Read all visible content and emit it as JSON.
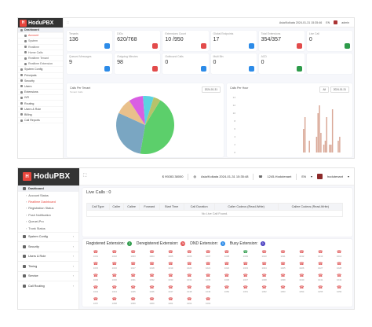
{
  "top": {
    "brand": "HoduPBX",
    "topbar": {
      "expand_icon": "expand-icon",
      "timezone": "Asia/Kolkata 2024-01-31 15:35:46",
      "language": "EN",
      "user": "admin"
    },
    "sidebar": [
      "Dashboard",
      "Account",
      "System",
      "Realtime",
      "Home Calls",
      "Realtime Tenant",
      "Realtime Extension",
      "System Config",
      "Principals",
      "Security",
      "Users",
      "Extensions",
      "IVR",
      "Routing",
      "Users & Role",
      "Billing",
      "Call Reports"
    ],
    "cards": [
      {
        "label": "Tenants",
        "value": "136",
        "color": "#2c8be8"
      },
      {
        "label": "DIDs",
        "value": "620/768",
        "color": "#e24b4b"
      },
      {
        "label": "Extensions Count",
        "value": "10 /950",
        "color": "#e24b4b"
      },
      {
        "label": "Global Endpoints",
        "value": "17",
        "color": "#2c8be8"
      },
      {
        "label": "Total Extensions",
        "value": "354/357",
        "color": "#e24b4b"
      },
      {
        "label": "Live Call",
        "value": "0",
        "color": "#2d9b4a"
      },
      {
        "label": "Queued Messages",
        "value": "9",
        "color": "#2c8be8"
      },
      {
        "label": "Outgoing Minutes",
        "value": "98",
        "color": "#e24b4b"
      },
      {
        "label": "Outbound Calls",
        "value": "0",
        "color": "#2c8be8"
      },
      {
        "label": "Multi Bin",
        "value": "0",
        "color": "#2c8be8"
      },
      {
        "label": "ACD",
        "value": "0",
        "color": "#2d9b4a"
      },
      {
        "label": "",
        "value": "",
        "color": "#ffffff"
      }
    ],
    "pie_panel": {
      "title": "Calls Per Tenant",
      "subtitle": "Tenant Calls",
      "date": "2024-01-31"
    },
    "bar_panel": {
      "title": "Calls Per Hour",
      "select": "All",
      "date": "2024-01-31"
    },
    "chart_data": [
      {
        "type": "pie",
        "title": "Calls Per Tenant",
        "slices": [
          {
            "value": 44,
            "color": "#5ccf6b"
          },
          {
            "value": 29,
            "color": "#7aa6c2"
          },
          {
            "value": 9,
            "color": "#e9c08b"
          },
          {
            "value": 8,
            "color": "#d95ee3"
          },
          {
            "value": 6,
            "color": "#5bd3e1"
          },
          {
            "value": 4,
            "color": "#b7c26a"
          }
        ]
      },
      {
        "type": "bar",
        "title": "Calls Per Hour",
        "y_ticks": [
          "14",
          "12",
          "10",
          "8",
          "6",
          "4",
          "2",
          "0"
        ],
        "ylim": [
          0,
          14
        ],
        "values": [
          0,
          0,
          0,
          0,
          0,
          0,
          0,
          0,
          0,
          0,
          0,
          0,
          0,
          0,
          0,
          0,
          0,
          0,
          0,
          0,
          0,
          0,
          0,
          0,
          0,
          0,
          0,
          0,
          0,
          0,
          0,
          0,
          0,
          0,
          0,
          0,
          0,
          0,
          0,
          0,
          0,
          0,
          0,
          0,
          0,
          6,
          9,
          0,
          0,
          3,
          0,
          0,
          0,
          0,
          4,
          10,
          12,
          5,
          0,
          2,
          3,
          9,
          0,
          2,
          2,
          11,
          0,
          0,
          0,
          3,
          4,
          0,
          0,
          0,
          0,
          0
        ],
        "color": "#d9a796"
      }
    ]
  },
  "bottom": {
    "brand": "HoduPBX",
    "header": {
      "balance": "$ 99283.38000",
      "timezone": "Asia/Kolkata 2024-01-31 15:35:48",
      "did": "1245-Hodutenant",
      "language": "EN",
      "user": "hodutenant"
    },
    "sidebar": {
      "dashboard": "Dashboard",
      "subitems": [
        "Account Status",
        "Realtime Dashboard",
        "Registration Status",
        "Push Notification",
        "QueueLPro",
        "Trunk Status"
      ],
      "main": [
        "System Config",
        "Security",
        "Users & Role",
        "Timing",
        "Service",
        "Call Routing"
      ]
    },
    "live_calls": {
      "title": "Live Calls : 0",
      "columns": [
        "Call Type",
        "Caller",
        "Callee",
        "Forward",
        "Start Time",
        "Call Duration",
        "Caller Codecs (Read-Write)",
        "Callee Codecs (Read-Write)"
      ],
      "empty_text": "No Live Call Found."
    },
    "extensions": {
      "registered_label": "Registered Extension:",
      "registered_count": "2",
      "deregistered_label": "Deregistered Extension:",
      "deregistered_count": "26",
      "dnd_label": "DND Extension:",
      "dnd_count": "0",
      "busy_label": "Busy Extension:",
      "busy_count": "0",
      "colors": {
        "registered": "#2d9b4a",
        "deregistered": "#e24b4b",
        "dnd": "#2c8be8",
        "busy": "#4a3fc1"
      },
      "items": [
        {
          "num": "1001",
          "status": "de"
        },
        {
          "num": "1002",
          "status": "de"
        },
        {
          "num": "1003",
          "status": "de"
        },
        {
          "num": "1004",
          "status": "de"
        },
        {
          "num": "1005",
          "status": "de"
        },
        {
          "num": "1006",
          "status": "de"
        },
        {
          "num": "1007",
          "status": "de"
        },
        {
          "num": "1008",
          "status": "de"
        },
        {
          "num": "1009",
          "status": "reg"
        },
        {
          "num": "1010",
          "status": "de"
        },
        {
          "num": "1011",
          "status": "de"
        },
        {
          "num": "1012",
          "status": "de"
        },
        {
          "num": "1013",
          "status": "de"
        },
        {
          "num": "1014",
          "status": "de"
        },
        {
          "num": "1015",
          "status": "de"
        },
        {
          "num": "1016",
          "status": "de"
        },
        {
          "num": "1017",
          "status": "de"
        },
        {
          "num": "1018",
          "status": "de"
        },
        {
          "num": "1019",
          "status": "de"
        },
        {
          "num": "1020",
          "status": "de"
        },
        {
          "num": "1021",
          "status": "de"
        },
        {
          "num": "1022",
          "status": "de"
        },
        {
          "num": "1023",
          "status": "de"
        },
        {
          "num": "1024",
          "status": "de"
        },
        {
          "num": "1025",
          "status": "de"
        },
        {
          "num": "1026",
          "status": "de"
        },
        {
          "num": "1027",
          "status": "de"
        },
        {
          "num": "1028",
          "status": "de"
        },
        {
          "num": "1029",
          "status": "de"
        },
        {
          "num": "1030",
          "status": "de"
        },
        {
          "num": "1031",
          "status": "de"
        },
        {
          "num": "1032",
          "status": "de"
        },
        {
          "num": "1033",
          "status": "de"
        },
        {
          "num": "1034",
          "status": "de"
        },
        {
          "num": "1035",
          "status": "de"
        },
        {
          "num": "1036",
          "status": "de"
        },
        {
          "num": "1037",
          "status": "de"
        },
        {
          "num": "1038",
          "status": "de"
        },
        {
          "num": "1039",
          "status": "de"
        },
        {
          "num": "1040",
          "status": "de"
        },
        {
          "num": "1041",
          "status": "de"
        },
        {
          "num": "1042",
          "status": "de"
        },
        {
          "num": "1043",
          "status": "de"
        },
        {
          "num": "1044",
          "status": "de"
        },
        {
          "num": "1045",
          "status": "de"
        },
        {
          "num": "1046",
          "status": "de"
        },
        {
          "num": "1047",
          "status": "de"
        },
        {
          "num": "1048",
          "status": "de"
        },
        {
          "num": "1049",
          "status": "de"
        },
        {
          "num": "1050",
          "status": "de"
        },
        {
          "num": "1051",
          "status": "de"
        },
        {
          "num": "1052",
          "status": "de"
        },
        {
          "num": "1053",
          "status": "de"
        },
        {
          "num": "1054",
          "status": "de"
        },
        {
          "num": "1055",
          "status": "de"
        },
        {
          "num": "1056",
          "status": "de"
        },
        {
          "num": "1057",
          "status": "de"
        },
        {
          "num": "1058",
          "status": "de"
        },
        {
          "num": "1059",
          "status": "de"
        },
        {
          "num": "1060",
          "status": "de"
        },
        {
          "num": "1061",
          "status": "de"
        },
        {
          "num": "1062",
          "status": "de"
        },
        {
          "num": "1063",
          "status": "de"
        }
      ]
    }
  }
}
